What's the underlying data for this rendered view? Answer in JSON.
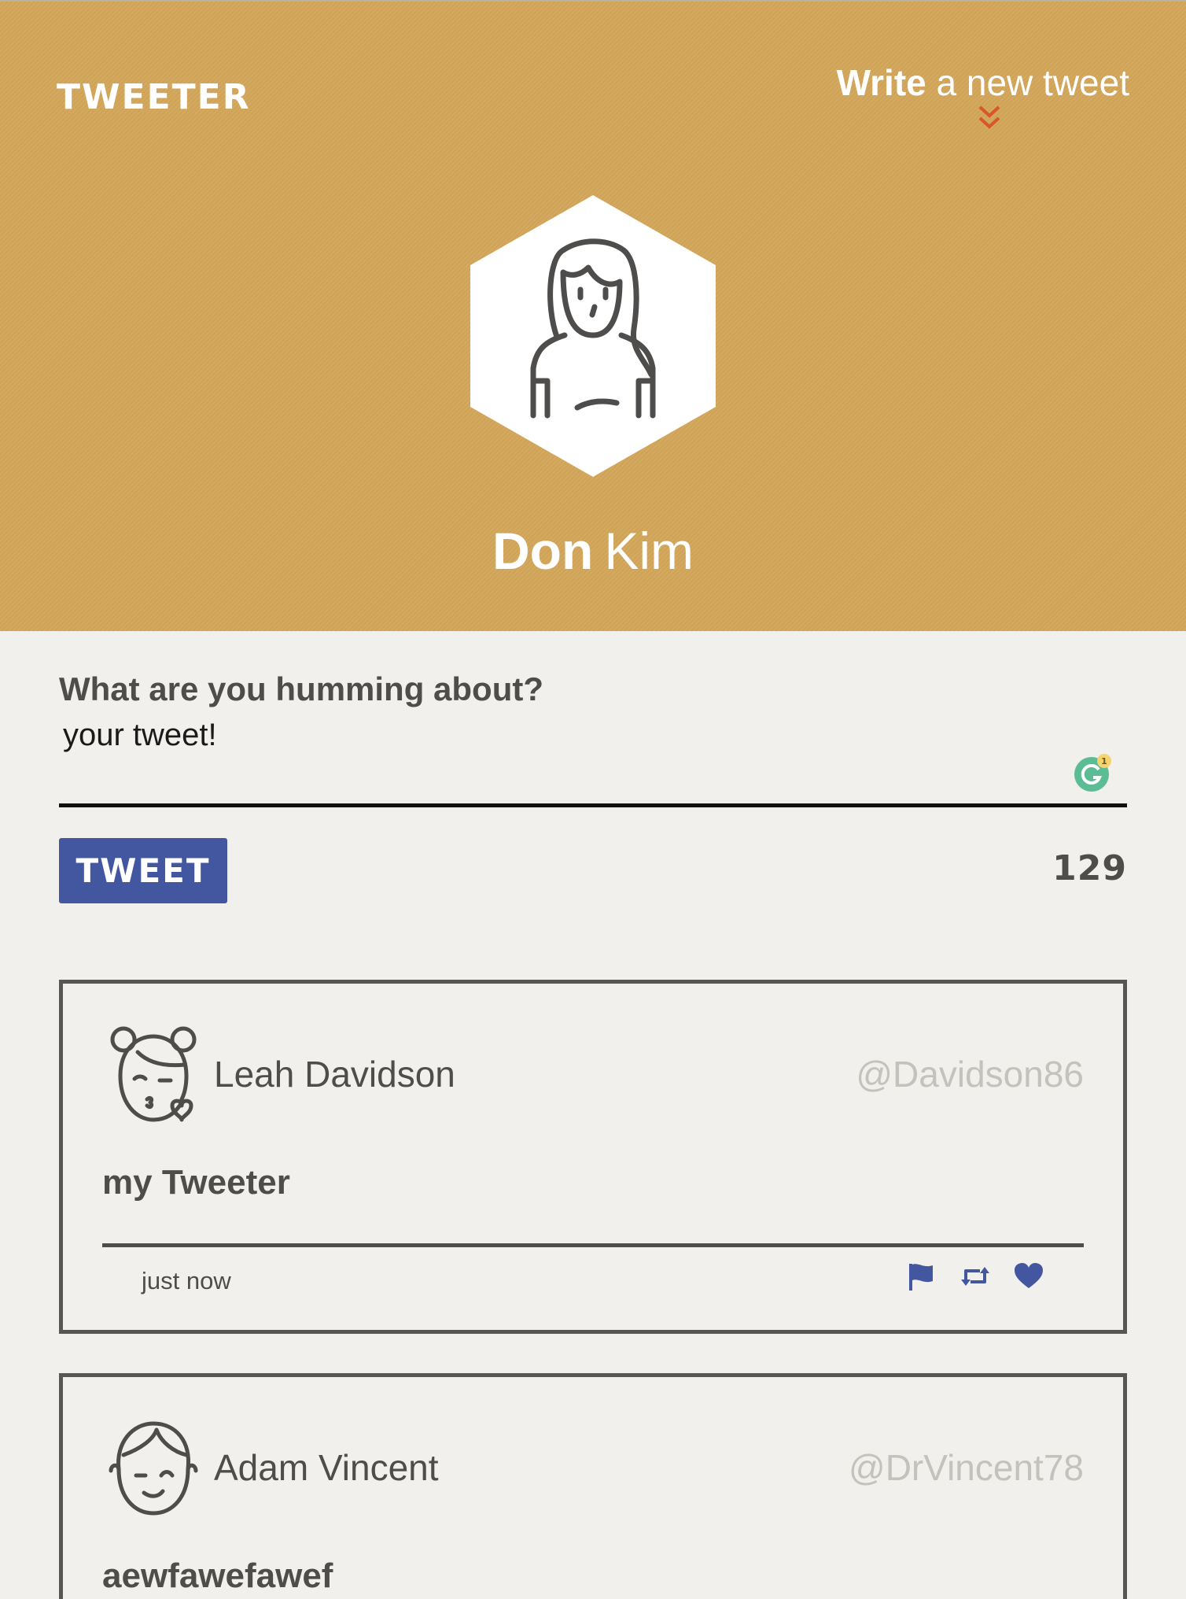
{
  "header": {
    "logo": "TWEETER",
    "compose_link_bold": "Write",
    "compose_link_rest": "a new tweet",
    "accent_color": "#d3a75a"
  },
  "profile": {
    "first_name": "Don",
    "last_name": "Kim"
  },
  "composer": {
    "label": "What are you humming about?",
    "input_value": "your tweet!",
    "tweet_button_label": "TWEET",
    "char_counter": "129",
    "grammarly_badge_count": "1"
  },
  "tweets": [
    {
      "name": "Leah Davidson",
      "handle": "@Davidson86",
      "content": "my Tweeter",
      "time": "just now",
      "icons": [
        "flag-icon",
        "retweet-icon",
        "heart-icon"
      ]
    },
    {
      "name": "Adam Vincent",
      "handle": "@DrVincent78",
      "content": "aewfawefawef"
    }
  ],
  "colors": {
    "button_blue": "#4356a0",
    "chevron_red": "#d9552c",
    "page_bg": "#f1f0ec"
  }
}
